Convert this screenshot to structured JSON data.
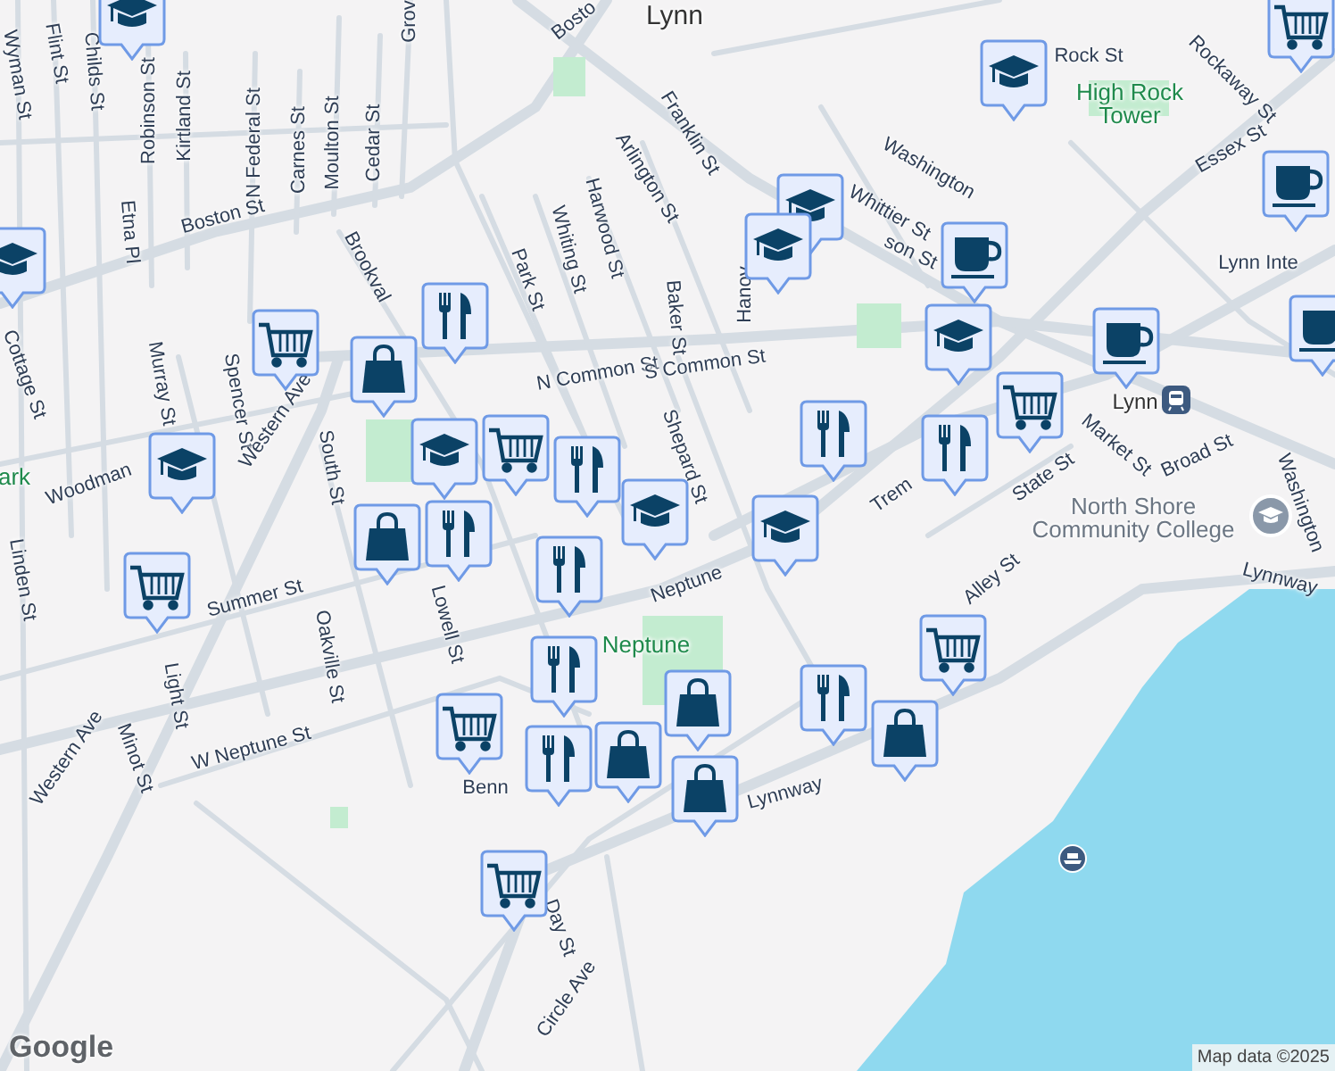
{
  "map": {
    "labels": [
      {
        "text": "Lynn",
        "kind": "city"
      },
      {
        "text": "Wyman St",
        "kind": "street"
      },
      {
        "text": "Flint St",
        "kind": "street"
      },
      {
        "text": "Childs St",
        "kind": "street"
      },
      {
        "text": "Robinson St",
        "kind": "street"
      },
      {
        "text": "Kirtland St",
        "kind": "street"
      },
      {
        "text": "N Federal St",
        "kind": "street"
      },
      {
        "text": "Carnes St",
        "kind": "street"
      },
      {
        "text": "Moulton St",
        "kind": "street"
      },
      {
        "text": "Cedar St",
        "kind": "street"
      },
      {
        "text": "Grov",
        "kind": "street"
      },
      {
        "text": "Bosto",
        "kind": "street"
      },
      {
        "text": "Boston St",
        "kind": "street"
      },
      {
        "text": "Etna Pl",
        "kind": "street"
      },
      {
        "text": "Brookval",
        "kind": "street"
      },
      {
        "text": "Park St",
        "kind": "street"
      },
      {
        "text": "Whiting St",
        "kind": "street"
      },
      {
        "text": "Harwood St",
        "kind": "street"
      },
      {
        "text": "Arlington St",
        "kind": "street"
      },
      {
        "text": "Franklin St",
        "kind": "street"
      },
      {
        "text": "Baker St",
        "kind": "street"
      },
      {
        "text": "Hanov",
        "kind": "street"
      },
      {
        "text": "Washington",
        "kind": "street"
      },
      {
        "text": "Whittier St",
        "kind": "street"
      },
      {
        "text": "son St",
        "kind": "street"
      },
      {
        "text": "Rock St",
        "kind": "street"
      },
      {
        "text": "High Rock Tower",
        "kind": "park"
      },
      {
        "text": "Rockaway St",
        "kind": "street"
      },
      {
        "text": "Essex St",
        "kind": "street"
      },
      {
        "text": "Lynn Inte",
        "kind": "street"
      },
      {
        "text": "N Common St",
        "kind": "street"
      },
      {
        "text": "S Common St",
        "kind": "street"
      },
      {
        "text": "Shepard St",
        "kind": "street"
      },
      {
        "text": "Cottage St",
        "kind": "street"
      },
      {
        "text": "Murray St",
        "kind": "street"
      },
      {
        "text": "Spencer St",
        "kind": "street"
      },
      {
        "text": "Woodman",
        "kind": "street"
      },
      {
        "text": "ark",
        "kind": "park"
      },
      {
        "text": "Western Ave",
        "kind": "street"
      },
      {
        "text": "South St",
        "kind": "street"
      },
      {
        "text": "Summer St",
        "kind": "street"
      },
      {
        "text": "Oakville St",
        "kind": "street"
      },
      {
        "text": "Linden St",
        "kind": "street"
      },
      {
        "text": "Lowell St",
        "kind": "street"
      },
      {
        "text": "Light St",
        "kind": "street"
      },
      {
        "text": "Neptune",
        "kind": "street"
      },
      {
        "text": "Neptune",
        "kind": "park"
      },
      {
        "text": "Trem",
        "kind": "street"
      },
      {
        "text": "State St",
        "kind": "street"
      },
      {
        "text": "Market St",
        "kind": "street"
      },
      {
        "text": "Lynn",
        "kind": "station"
      },
      {
        "text": "Broad St",
        "kind": "street"
      },
      {
        "text": "North Shore Community College",
        "kind": "poi"
      },
      {
        "text": "Washington",
        "kind": "street"
      },
      {
        "text": "Alley St",
        "kind": "street"
      },
      {
        "text": "Lynnway",
        "kind": "street"
      },
      {
        "text": "W Neptune St",
        "kind": "street"
      },
      {
        "text": "Minot St",
        "kind": "street"
      },
      {
        "text": "Western Ave",
        "kind": "street"
      },
      {
        "text": "Day St",
        "kind": "street"
      },
      {
        "text": "Circle Ave",
        "kind": "street"
      },
      {
        "text": "Lynnway",
        "kind": "street"
      },
      {
        "text": "Benn",
        "kind": "street"
      }
    ],
    "markers": [
      {
        "kind": "school"
      },
      {
        "kind": "school"
      },
      {
        "kind": "school"
      },
      {
        "kind": "school"
      },
      {
        "kind": "school"
      },
      {
        "kind": "school"
      },
      {
        "kind": "school"
      },
      {
        "kind": "school"
      },
      {
        "kind": "school"
      },
      {
        "kind": "school"
      },
      {
        "kind": "grocery"
      },
      {
        "kind": "grocery"
      },
      {
        "kind": "grocery"
      },
      {
        "kind": "grocery"
      },
      {
        "kind": "grocery"
      },
      {
        "kind": "grocery"
      },
      {
        "kind": "grocery"
      },
      {
        "kind": "grocery"
      },
      {
        "kind": "cafe"
      },
      {
        "kind": "cafe"
      },
      {
        "kind": "cafe"
      },
      {
        "kind": "cafe"
      },
      {
        "kind": "shopping"
      },
      {
        "kind": "shopping"
      },
      {
        "kind": "shopping"
      },
      {
        "kind": "shopping"
      },
      {
        "kind": "shopping"
      },
      {
        "kind": "shopping"
      },
      {
        "kind": "restaurant"
      },
      {
        "kind": "restaurant"
      },
      {
        "kind": "restaurant"
      },
      {
        "kind": "restaurant"
      },
      {
        "kind": "restaurant"
      },
      {
        "kind": "restaurant"
      },
      {
        "kind": "restaurant"
      },
      {
        "kind": "restaurant"
      },
      {
        "kind": "restaurant"
      }
    ],
    "logo": "Google",
    "attribution": "Map data ©2025"
  }
}
